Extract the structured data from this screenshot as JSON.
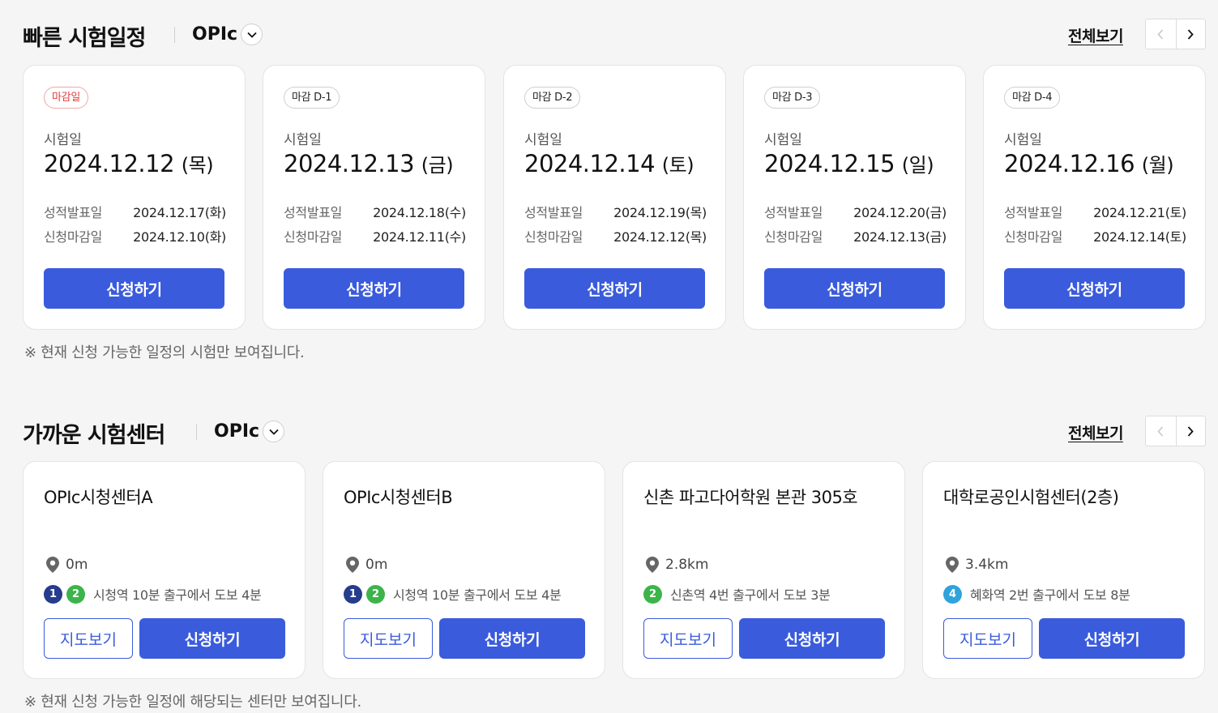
{
  "schedule": {
    "title": "빠른 시험일정",
    "exam": "OPIc",
    "view_all": "전체보기",
    "note": "※ 현재 신청 가능한 일정의 시험만 보여집니다.",
    "cards": [
      {
        "badge": "마감일",
        "exam_label": "시험일",
        "date": "2024.12.12",
        "dow": "(목)",
        "result_label": "성적발표일",
        "result_date": "2024.12.17(화)",
        "deadline_label": "신청마감일",
        "deadline_date": "2024.12.10(화)",
        "apply": "신청하기"
      },
      {
        "badge": "마감 D-1",
        "exam_label": "시험일",
        "date": "2024.12.13",
        "dow": "(금)",
        "result_label": "성적발표일",
        "result_date": "2024.12.18(수)",
        "deadline_label": "신청마감일",
        "deadline_date": "2024.12.11(수)",
        "apply": "신청하기"
      },
      {
        "badge": "마감 D-2",
        "exam_label": "시험일",
        "date": "2024.12.14",
        "dow": "(토)",
        "result_label": "성적발표일",
        "result_date": "2024.12.19(목)",
        "deadline_label": "신청마감일",
        "deadline_date": "2024.12.12(목)",
        "apply": "신청하기"
      },
      {
        "badge": "마감 D-3",
        "exam_label": "시험일",
        "date": "2024.12.15",
        "dow": "(일)",
        "result_label": "성적발표일",
        "result_date": "2024.12.20(금)",
        "deadline_label": "신청마감일",
        "deadline_date": "2024.12.13(금)",
        "apply": "신청하기"
      },
      {
        "badge": "마감 D-4",
        "exam_label": "시험일",
        "date": "2024.12.16",
        "dow": "(월)",
        "result_label": "성적발표일",
        "result_date": "2024.12.21(토)",
        "deadline_label": "신청마감일",
        "deadline_date": "2024.12.14(토)",
        "apply": "신청하기"
      }
    ]
  },
  "centers": {
    "title": "가까운 시험센터",
    "exam": "OPIc",
    "view_all": "전체보기",
    "note": "※ 현재 신청 가능한 일정에 해당되는 센터만 보여집니다.",
    "cards": [
      {
        "name": "OPIc시청센터A",
        "distance": "0m",
        "lines": [
          {
            "num": "1",
            "color": "#263c8c"
          },
          {
            "num": "2",
            "color": "#3cb44a"
          }
        ],
        "route": "시청역 10분 출구에서 도보 4분",
        "map": "지도보기",
        "apply": "신청하기"
      },
      {
        "name": "OPIc시청센터B",
        "distance": "0m",
        "lines": [
          {
            "num": "1",
            "color": "#263c8c"
          },
          {
            "num": "2",
            "color": "#3cb44a"
          }
        ],
        "route": "시청역 10분 출구에서 도보 4분",
        "map": "지도보기",
        "apply": "신청하기"
      },
      {
        "name": "신촌 파고다어학원 본관 305호",
        "distance": "2.8km",
        "lines": [
          {
            "num": "2",
            "color": "#3cb44a"
          }
        ],
        "route": "신촌역 4번 출구에서 도보 3분",
        "map": "지도보기",
        "apply": "신청하기"
      },
      {
        "name": "대학로공인시험센터(2층)",
        "distance": "3.4km",
        "lines": [
          {
            "num": "4",
            "color": "#2fa3dc"
          }
        ],
        "route": "혜화역 2번 출구에서 도보 8분",
        "map": "지도보기",
        "apply": "신청하기"
      }
    ]
  },
  "colors": {
    "primary": "#3a5bdc",
    "deadline_red": "#e23b3b"
  }
}
